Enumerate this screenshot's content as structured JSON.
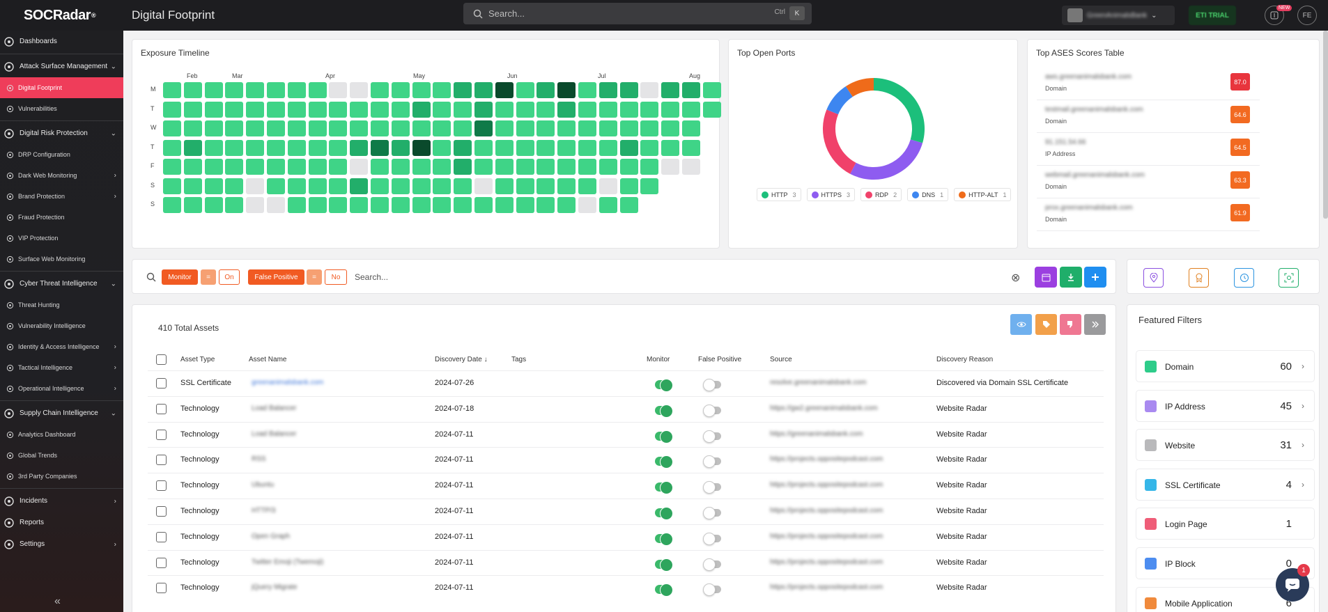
{
  "app": {
    "logo": "SOCRadar",
    "page_title": "Digital Footprint"
  },
  "search": {
    "placeholder": "Search...",
    "shortcut_1": "Ctrl",
    "shortcut_2": "K"
  },
  "topbar": {
    "org_name": "GreenAnimalsBank",
    "plan_label": "ETI TRIAL",
    "new_badge": "NEW",
    "avatar_initials": "FE"
  },
  "sidebar": {
    "items": [
      {
        "label": "Dashboards",
        "type": "section",
        "icon": "dashboard-icon"
      },
      {
        "label": "Attack Surface Management",
        "type": "section",
        "icon": "asm-icon",
        "chevron": "⌄"
      },
      {
        "label": "Digital Footprint",
        "type": "sub",
        "active": true,
        "icon": "globe-icon"
      },
      {
        "label": "Vulnerabilities",
        "type": "sub",
        "icon": "bug-icon"
      },
      {
        "label": "Digital Risk Protection",
        "type": "section",
        "icon": "shield-icon",
        "chevron": "⌄"
      },
      {
        "label": "DRP Configuration",
        "type": "sub",
        "icon": "config-icon"
      },
      {
        "label": "Dark Web Monitoring",
        "type": "sub",
        "icon": "darkweb-icon",
        "chevron": "›"
      },
      {
        "label": "Brand Protection",
        "type": "sub",
        "icon": "brand-icon",
        "chevron": "›"
      },
      {
        "label": "Fraud Protection",
        "type": "sub",
        "icon": "fraud-icon"
      },
      {
        "label": "VIP Protection",
        "type": "sub",
        "icon": "vip-icon"
      },
      {
        "label": "Surface Web Monitoring",
        "type": "sub",
        "icon": "surface-icon"
      },
      {
        "label": "Cyber Threat Intelligence",
        "type": "section",
        "icon": "cti-icon",
        "chevron": "⌄"
      },
      {
        "label": "Threat Hunting",
        "type": "sub",
        "icon": "hunt-icon"
      },
      {
        "label": "Vulnerability Intelligence",
        "type": "sub",
        "icon": "vulnintel-icon"
      },
      {
        "label": "Identity & Access Intelligence",
        "type": "sub",
        "icon": "identity-icon",
        "chevron": "›"
      },
      {
        "label": "Tactical Intelligence",
        "type": "sub",
        "icon": "tactical-icon",
        "chevron": "›"
      },
      {
        "label": "Operational Intelligence",
        "type": "sub",
        "icon": "operational-icon",
        "chevron": "›"
      },
      {
        "label": "Supply Chain Intelligence",
        "type": "section",
        "icon": "supply-icon",
        "chevron": "⌄"
      },
      {
        "label": "Analytics Dashboard",
        "type": "sub",
        "icon": "analytics-icon"
      },
      {
        "label": "Global Trends",
        "type": "sub",
        "icon": "trends-icon"
      },
      {
        "label": "3rd Party Companies",
        "type": "sub",
        "icon": "companies-icon"
      },
      {
        "label": "Incidents",
        "type": "section",
        "icon": "incidents-icon",
        "chevron": "›"
      },
      {
        "label": "Reports",
        "type": "section",
        "icon": "reports-icon"
      },
      {
        "label": "Settings",
        "type": "section",
        "icon": "settings-icon",
        "chevron": "›"
      }
    ],
    "collapse": "«"
  },
  "exposure": {
    "title": "Exposure Timeline",
    "months": [
      "Feb",
      "Mar",
      "Apr",
      "May",
      "Jun",
      "Jul",
      "Aug"
    ],
    "days": [
      "M",
      "T",
      "W",
      "T",
      "F",
      "S",
      "S"
    ],
    "grid": [
      "11111111ee1111224124122e221",
      "111111111111211211121111111",
      "11111111111111131111111111",
      "12111111123241211111112111",
      "111111111e11112111111111ee",
      "1111e1111211111e11111e11",
      "1111ee11111111111111e11"
    ]
  },
  "ports": {
    "title": "Top Open Ports",
    "legend": [
      {
        "name": "HTTP",
        "count": "3",
        "color": "#1cbf7b"
      },
      {
        "name": "HTTPS",
        "count": "3",
        "color": "#8e5cf0"
      },
      {
        "name": "RDP",
        "count": "2",
        "color": "#f0416a"
      },
      {
        "name": "DNS",
        "count": "1",
        "color": "#3d86f0"
      },
      {
        "name": "HTTP-ALT",
        "count": "1",
        "color": "#ef6b1a"
      }
    ]
  },
  "ases": {
    "title": "Top ASES Scores Table",
    "rows": [
      {
        "name": "aws.greenanimalsbank.com",
        "type": "Domain",
        "score": "87.0",
        "color": "#e8353d"
      },
      {
        "name": "testmail.greenanimalsbank.com",
        "type": "Domain",
        "score": "64.6",
        "color": "#f26a21"
      },
      {
        "name": "91.151.54.66",
        "type": "IP Address",
        "score": "64.5",
        "color": "#f26a21"
      },
      {
        "name": "webmail.greenanimalsbank.com",
        "type": "Domain",
        "score": "63.3",
        "color": "#f26a21"
      },
      {
        "name": "prox.greenanimalsbank.com",
        "type": "Domain",
        "score": "61.9",
        "color": "#f26a21"
      }
    ]
  },
  "filterbar": {
    "monitor": "Monitor",
    "eq1": "=",
    "on": "On",
    "fp": "False Positive",
    "eq2": "=",
    "no": "No",
    "placeholder": "Search...",
    "clear_icon": "⊗"
  },
  "assets": {
    "total": "410 Total Assets",
    "headers": [
      "Asset Type",
      "Asset Name",
      "Discovery Date ↓",
      "Tags",
      "Monitor",
      "False Positive",
      "Source",
      "Discovery Reason"
    ],
    "rows": [
      {
        "type": "SSL Certificate",
        "name": "greenanimalsbank.com",
        "date": "2024-07-26",
        "source": "resolve.greenanimalsbank.com",
        "reason": "Discovered via Domain SSL Certificate"
      },
      {
        "type": "Technology",
        "name": "Load Balancer",
        "date": "2024-07-18",
        "source": "https://gw2.greenanimalsbank.com",
        "reason": "Website Radar"
      },
      {
        "type": "Technology",
        "name": "Load Balancer",
        "date": "2024-07-11",
        "source": "https://greenanimalsbank.com",
        "reason": "Website Radar"
      },
      {
        "type": "Technology",
        "name": "RSS",
        "date": "2024-07-11",
        "source": "https://projects.oppositepodcast.com",
        "reason": "Website Radar"
      },
      {
        "type": "Technology",
        "name": "Ubuntu",
        "date": "2024-07-11",
        "source": "https://projects.oppositepodcast.com",
        "reason": "Website Radar"
      },
      {
        "type": "Technology",
        "name": "HTTP/3",
        "date": "2024-07-11",
        "source": "https://projects.oppositepodcast.com",
        "reason": "Website Radar"
      },
      {
        "type": "Technology",
        "name": "Open Graph",
        "date": "2024-07-11",
        "source": "https://projects.oppositepodcast.com",
        "reason": "Website Radar"
      },
      {
        "type": "Technology",
        "name": "Twitter Emoji (Twemoji)",
        "date": "2024-07-11",
        "source": "https://projects.oppositepodcast.com",
        "reason": "Website Radar"
      },
      {
        "type": "Technology",
        "name": "jQuery Migrate",
        "date": "2024-07-11",
        "source": "https://projects.oppositepodcast.com",
        "reason": "Website Radar"
      }
    ]
  },
  "featured": {
    "title": "Featured Filters",
    "items": [
      {
        "label": "Domain",
        "count": "60",
        "color": "#2ecc8a",
        "chev": "›"
      },
      {
        "label": "IP Address",
        "count": "45",
        "color": "#a98af0",
        "chev": "›"
      },
      {
        "label": "Website",
        "count": "31",
        "color": "#b9b9bb",
        "chev": "›"
      },
      {
        "label": "SSL Certificate",
        "count": "4",
        "color": "#35b6e8",
        "chev": "›"
      },
      {
        "label": "Login Page",
        "count": "1",
        "color": "#ef5d78",
        "chev": ""
      },
      {
        "label": "IP Block",
        "count": "0",
        "color": "#4d8df0",
        "chev": ""
      },
      {
        "label": "Mobile Application",
        "count": "6",
        "color": "#f08a3c",
        "chev": ""
      }
    ]
  },
  "chat": {
    "badge": "1"
  }
}
